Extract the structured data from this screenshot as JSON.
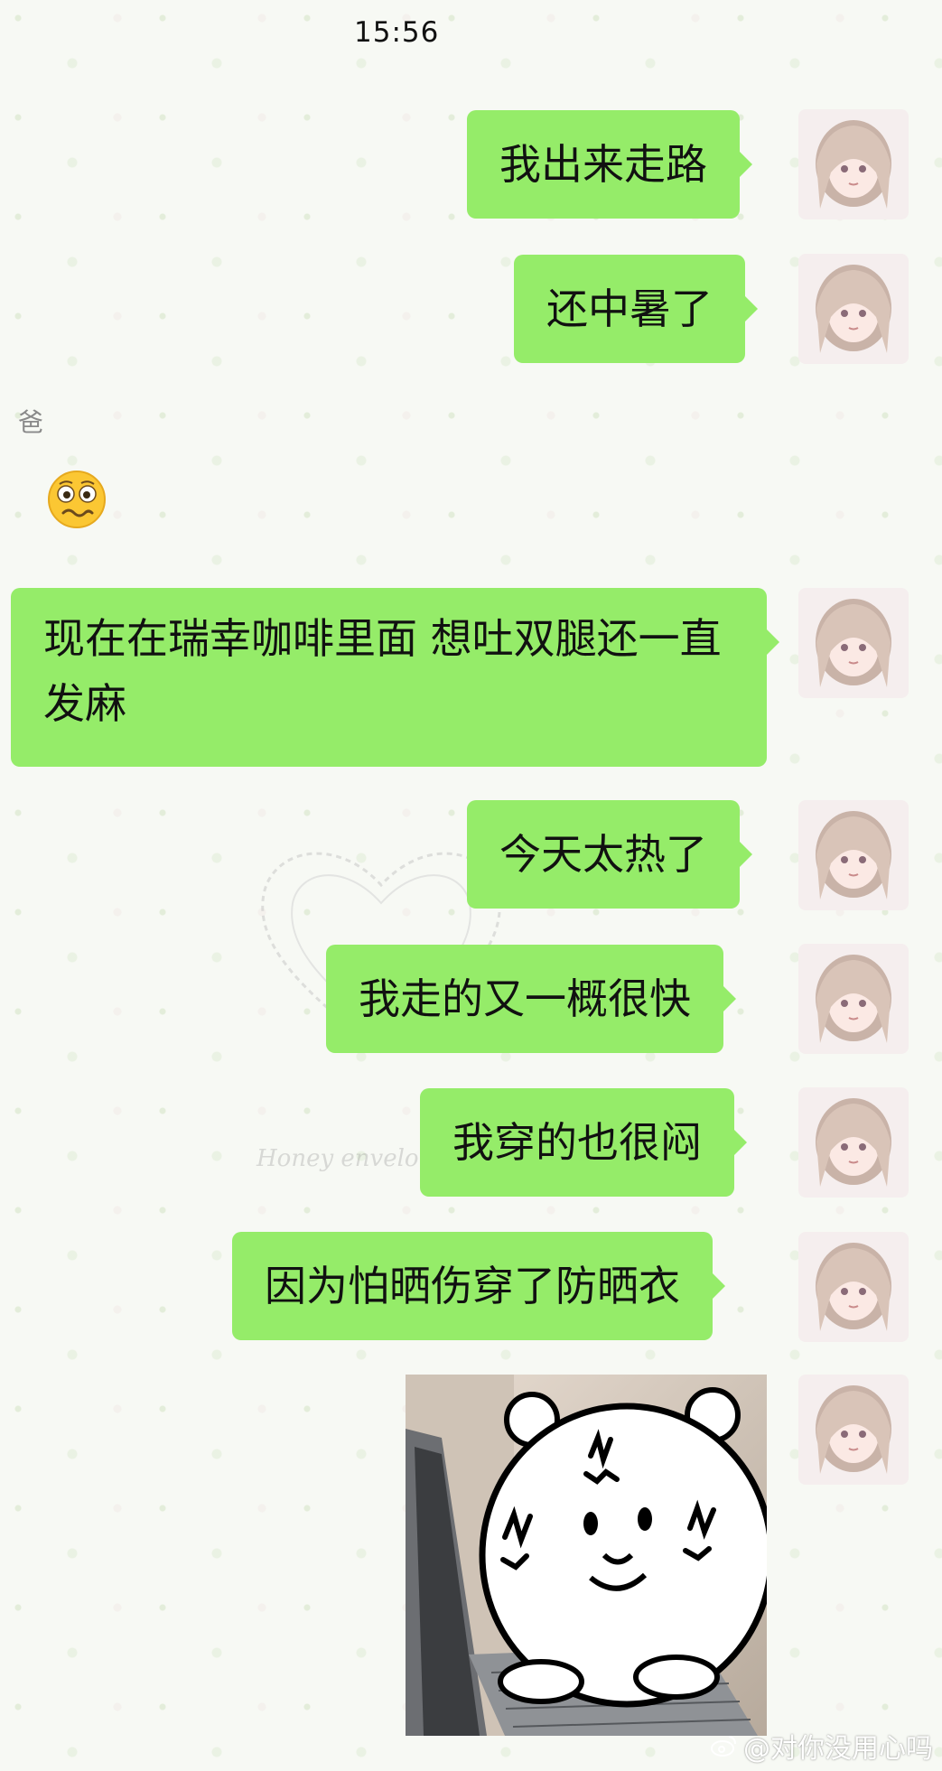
{
  "status_bar": {
    "time": "15:56"
  },
  "contact": {
    "name": "爸"
  },
  "messages": [
    {
      "side": "self",
      "type": "text",
      "text": "我出来走路"
    },
    {
      "side": "self",
      "type": "text",
      "text": "还中暑了"
    },
    {
      "side": "other",
      "type": "emoji",
      "emoji": "woozy-face-icon"
    },
    {
      "side": "self",
      "type": "text",
      "text": "现在在瑞幸咖啡里面 想吐双腿还一直发麻"
    },
    {
      "side": "self",
      "type": "text",
      "text": "今天太热了"
    },
    {
      "side": "self",
      "type": "text",
      "text": "我走的又一概很快"
    },
    {
      "side": "self",
      "type": "text",
      "text": "我穿的也很闷"
    },
    {
      "side": "self",
      "type": "text",
      "text": "因为怕晒伤穿了防晒衣"
    },
    {
      "side": "self",
      "type": "sticker",
      "sticker": "angry-bear-at-laptop-sticker"
    }
  ],
  "wallpaper": {
    "watermark_text": "Honey envelo"
  },
  "watermark": {
    "text": "@对你没用心吗"
  },
  "colors": {
    "bubble_self": "#95ec69",
    "background": "#f7f9f4"
  }
}
